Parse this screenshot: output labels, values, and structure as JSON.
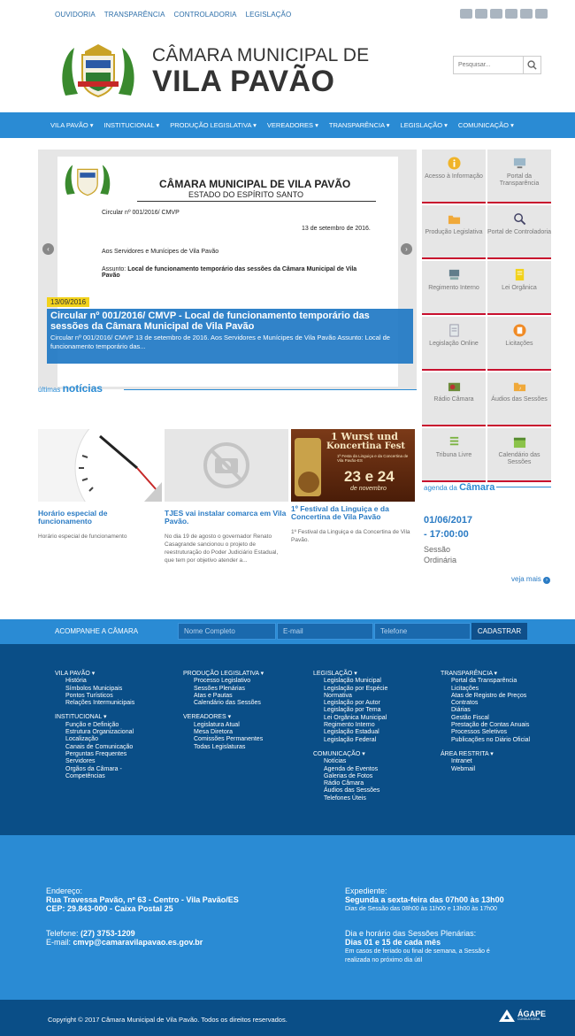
{
  "top_links": [
    "OUVIDORIA",
    "TRANSPARÊNCIA",
    "CONTROLADORIA",
    "LEGISLAÇÃO"
  ],
  "header": {
    "line1": "CÂMARA MUNICIPAL DE",
    "line2": "VILA PAVÃO",
    "search_placeholder": "Pesquisar..."
  },
  "nav": [
    "VILA PAVÃO",
    "INSTITUCIONAL",
    "PRODUÇÃO LEGISLATIVA",
    "VEREADORES",
    "TRANSPARÊNCIA",
    "LEGISLAÇÃO",
    "COMUNICAÇÃO"
  ],
  "slide": {
    "doc_title": "CÂMARA MUNICIPAL DE VILA PAVÃO",
    "doc_sub": "ESTADO DO ESPÍRITO SANTO",
    "doc_ref": "Circular nº 001/2016/ CMVP",
    "doc_date": "13 de setembro de 2016.",
    "doc_to": "Aos Servidores e Munícipes de Vila Pavão",
    "doc_subject_label": "Assunto:",
    "doc_subject": "Local de funcionamento temporário das sessões da Câmara Municipal de Vila Pavão",
    "date": "13/09/2016",
    "title": "Circular nº 001/2016/ CMVP - Local de funcionamento temporário das sessões da Câmara Municipal de Vila Pavão",
    "excerpt": "Circular nº 001/2016/ CMVP 13 de setembro de 2016. Aos Servidores e Munícipes de Vila Pavão Assunto: Local de funcionamento temporário das..."
  },
  "tiles": [
    "Acesso à Informação",
    "Portal da Transparência",
    "Produção Legislativa",
    "Portal de Controladoria",
    "Regimento Interno",
    "Lei Orgânica",
    "Legislação Online",
    "Licitações",
    "Rádio Câmara",
    "Áudios das Sessões",
    "Tribuna Livre",
    "Calendário das Sessões"
  ],
  "news_header": {
    "prefix": "últimas",
    "bold": "notícias"
  },
  "news": [
    {
      "title": "Horário especial de funcionamento",
      "desc": "Horário especial de funcionamento"
    },
    {
      "title": "TJES vai instalar comarca em Vila Pavão.",
      "desc": "No dia 19 de agosto o governador Renato Casagrande sancionou o projeto de reestruturação do Poder Judiciário Estadual, que tem por objetivo atender a..."
    },
    {
      "title": "1º Festival da Linguiça e da Concertina de Vila Pavão",
      "desc": "1º Festival da Linguiça e da Concertina de Vila Pavão."
    }
  ],
  "festival_img": {
    "l1": "1 Wurst und",
    "l2": "Koncertina Fest",
    "l3": "1ª Festa da Linguiça e da Concertina de Vila Pavão-ES",
    "l4": "23 e 24",
    "l5": "de novembro"
  },
  "agenda": {
    "prefix": "agenda da",
    "bold": "Câmara",
    "date": "01/06/2017",
    "time": "- 17:00:00",
    "sub": "Sessão Ordinária",
    "more": "veja mais"
  },
  "subscribe": {
    "label": "ACOMPANHE A CÂMARA",
    "name": "Nome Completo",
    "email": "E-mail",
    "phone": "Telefone",
    "button": "CADASTRAR"
  },
  "footer_cols": [
    [
      {
        "h": "VILA PAVÃO",
        "items": [
          "História",
          "Símbolos Municipais",
          "Pontos Turísticos",
          "Relações Intermunicipais"
        ]
      },
      {
        "h": "INSTITUCIONAL",
        "items": [
          "Função e Definição",
          "Estrutura Organizacional",
          "Localização",
          "Canais de Comunicação",
          "Perguntas Frequentes",
          "Servidores",
          "Orgãos da Câmara -",
          "Competências"
        ]
      }
    ],
    [
      {
        "h": "PRODUÇÃO LEGISLATIVA",
        "items": [
          "Processo Legislativo",
          "Sessões Plenárias",
          "Atas e Pautas",
          "Calendário das Sessões"
        ]
      },
      {
        "h": "VEREADORES",
        "items": [
          "Legislatura Atual",
          "Mesa Diretora",
          "Comissões Permanentes",
          "Todas Legislaturas"
        ]
      }
    ],
    [
      {
        "h": "LEGISLAÇÃO",
        "items": [
          "Legislação Municipal",
          "Legislação por Espécie",
          "Normativa",
          "Legislação por Autor",
          "Legislação por Tema",
          "Lei Orgânica Municipal",
          "Regimento Interno",
          "Legislação Estadual",
          "Legislação Federal"
        ]
      },
      {
        "h": "COMUNICAÇÃO",
        "items": [
          "Notícias",
          "Agenda de Eventos",
          "Galerias de Fotos",
          "Rádio Câmara",
          "Áudios das Sessões",
          "Telefones Úteis"
        ]
      }
    ],
    [
      {
        "h": "TRANSPARÊNCIA",
        "items": [
          "Portal da Transparência",
          "Licitações",
          "Atas de Registro de Preços",
          "Contratos",
          "Diárias",
          "Gestão Fiscal",
          "Prestação de Contas Anuais",
          "Processos Seletivos",
          "Publicações no Diário Oficial"
        ]
      },
      {
        "h": "ÁREA RESTRITA",
        "items": [
          "Intranet",
          "Webmail"
        ]
      }
    ]
  ],
  "address": {
    "label": "Endereço:",
    "line1": "Rua Travessa Pavão, nº 63 - Centro - Vila Pavão/ES",
    "line2": "CEP: 29.843-000 - Caixa Postal 25",
    "phone_label": "Telefone:",
    "phone": "(27) 3753-1209",
    "email_label": "E-mail:",
    "email": "cmvp@camaravilapavao.es.gov.br",
    "exp_label": "Expediente:",
    "exp_bold": "Segunda a sexta-feira das 07h00 às 13h00",
    "exp_sub": "Dias de Sessão das 08h00 às 11h00 e 13h00 às 17h00",
    "ses_label": "Dia e horário das Sessões Plenárias:",
    "ses_bold": "Dias 01 e 15 de cada mês",
    "ses_sub1": "Em casos de feriado ou final de semana, a Sessão é",
    "ses_sub2": "realizada no próximo dia útil"
  },
  "copyright": "Copyright © 2017 Câmara Municipal de Vila Pavão. Todos os direitos reservados.",
  "agape": {
    "brand": "ÁGAPE",
    "sub": "CONSULTORIA"
  }
}
